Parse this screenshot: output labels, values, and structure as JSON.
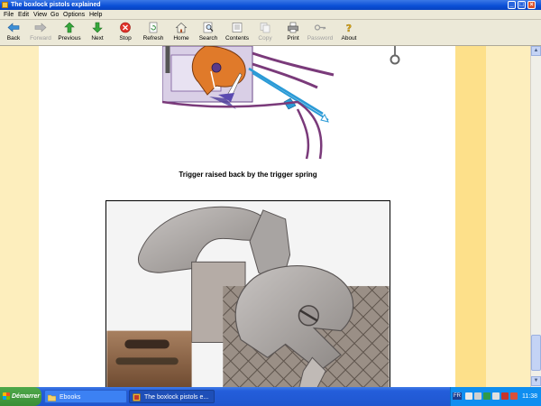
{
  "window": {
    "title": "The boxlock pistols explained",
    "controls": [
      "_",
      "□",
      "×"
    ]
  },
  "menu": [
    "File",
    "Edit",
    "View",
    "Go",
    "Options",
    "Help"
  ],
  "toolbar": {
    "buttons": [
      {
        "label": "Back",
        "icon": "back-arrow-icon",
        "enabled": true
      },
      {
        "label": "Forward",
        "icon": "forward-arrow-icon",
        "enabled": false
      },
      {
        "label": "Previous",
        "icon": "up-arrow-icon",
        "enabled": true
      },
      {
        "label": "Next",
        "icon": "down-arrow-icon",
        "enabled": true
      },
      {
        "label": "Stop",
        "icon": "stop-icon",
        "enabled": true
      },
      {
        "label": "Refresh",
        "icon": "refresh-icon",
        "enabled": true
      },
      {
        "label": "Home",
        "icon": "home-icon",
        "enabled": true
      },
      {
        "label": "Search",
        "icon": "search-icon",
        "enabled": true
      },
      {
        "label": "Contents",
        "icon": "contents-icon",
        "enabled": true
      },
      {
        "label": "Copy",
        "icon": "copy-icon",
        "enabled": false
      },
      {
        "label": "Print",
        "icon": "print-icon",
        "enabled": true
      },
      {
        "label": "Password",
        "icon": "key-icon",
        "enabled": false
      },
      {
        "label": "About",
        "icon": "help-icon",
        "enabled": true
      }
    ]
  },
  "content": {
    "caption": "Trigger raised back by the trigger spring"
  },
  "taskbar": {
    "start_label": "Démarrer",
    "tasks": [
      {
        "label": "Ebooks",
        "active": false
      },
      {
        "label": "The boxlock pistols e...",
        "active": true
      }
    ],
    "tray_label": "FR",
    "clock": "11:38"
  },
  "colors": {
    "side_light": "#fdeebd",
    "side_dark": "#fde08a",
    "titlebar": "#0a4fd6"
  }
}
